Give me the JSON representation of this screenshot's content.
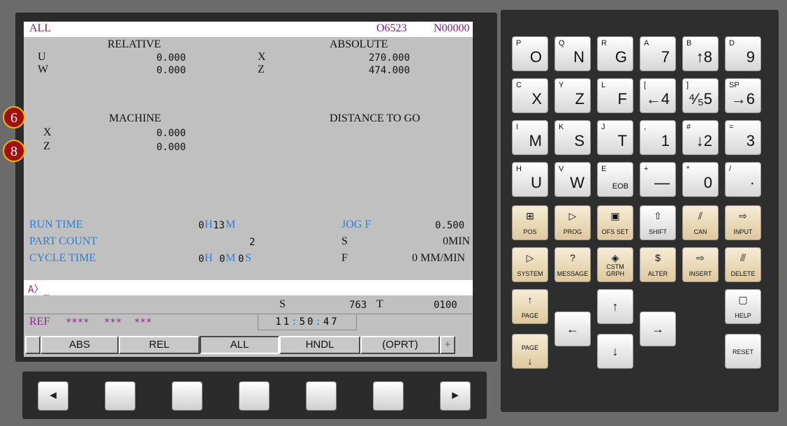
{
  "screen": {
    "mode_label": "ALL",
    "program_no": "O6523",
    "sequence_no": "N00000",
    "relative": {
      "title": "RELATIVE",
      "u_label": "U",
      "u_value": "0.000",
      "w_label": "W",
      "w_value": "0.000"
    },
    "absolute": {
      "title": "ABSOLUTE",
      "x_label": "X",
      "x_value": "270.000",
      "z_label": "Z",
      "z_value": "474.000"
    },
    "machine": {
      "title": "MACHINE",
      "x_label": "X",
      "x_value": "0.000",
      "z_label": "Z",
      "z_value": "0.000"
    },
    "distance_to_go": {
      "title": "DISTANCE TO GO"
    },
    "run_time": {
      "label": "RUN TIME",
      "h_value": "0",
      "h_unit": "H",
      "m_value": "13",
      "m_unit": "M"
    },
    "part_count": {
      "label": "PART COUNT",
      "value": "2"
    },
    "cycle_time": {
      "label": "CYCLE TIME",
      "h_value": "0",
      "h_unit": "H",
      "m_value": "0",
      "m_unit": "M",
      "s_value": "0",
      "s_unit": "S"
    },
    "jog_f": {
      "label": "JOG F",
      "value": "0.500"
    },
    "s_line": {
      "label": "S",
      "value": "0MIN"
    },
    "f_line": {
      "label": "F",
      "value": "0 MM/MIN"
    },
    "input_prompt": "A〉_",
    "spindle": {
      "label": "S",
      "value": "763"
    },
    "tool": {
      "label": "T",
      "value": "0100"
    },
    "status": {
      "mode": "REF",
      "s1": "****",
      "s2": "***",
      "s3": "***"
    },
    "clock": {
      "hh": "11",
      "mm": "50",
      "ss": "47",
      "sep": ":"
    },
    "softkeys": [
      "ABS",
      "REL",
      "ALL",
      "HNDL",
      "(OPRT)",
      "+"
    ],
    "active_softkey": "ALL"
  },
  "annotations": [
    "6",
    "8"
  ],
  "bottom_buttons": [
    "◄",
    "",
    "",
    "",
    "",
    "",
    "►"
  ],
  "keypad": {
    "rows": [
      [
        {
          "sub": "P",
          "main": "O"
        },
        {
          "sub": "Q",
          "main": "N"
        },
        {
          "sub": "R",
          "main": "G"
        },
        {
          "sub": "A",
          "main": "7"
        },
        {
          "sub": "B",
          "main": "↑8"
        },
        {
          "sub": "D",
          "main": "9"
        }
      ],
      [
        {
          "sub": "C",
          "main": "X"
        },
        {
          "sub": "Y",
          "main": "Z"
        },
        {
          "sub": "L",
          "main": "F"
        },
        {
          "sub": "[",
          "main": "←4"
        },
        {
          "sub": "]",
          "main": "⁴⁄₅5"
        },
        {
          "sub": "SP",
          "main": "→6"
        }
      ],
      [
        {
          "sub": "I",
          "main": "M"
        },
        {
          "sub": "K",
          "main": "S"
        },
        {
          "sub": "J",
          "main": "T"
        },
        {
          "sub": ",",
          "main": "1"
        },
        {
          "sub": "#",
          "main": "↓2"
        },
        {
          "sub": "=",
          "main": "3"
        }
      ],
      [
        {
          "sub": "H",
          "main": "U"
        },
        {
          "sub": "V",
          "main": "W"
        },
        {
          "sub": "E",
          "main": "EOB"
        },
        {
          "sub": "+",
          "main": "—"
        },
        {
          "sub": "*",
          "main": "0"
        },
        {
          "sub": "/",
          "main": "·"
        }
      ]
    ],
    "function_rows": [
      [
        {
          "icon": "⊞",
          "label": "POS"
        },
        {
          "icon": "▷",
          "label": "PROG"
        },
        {
          "icon": "▣",
          "label": "OFS SET"
        },
        {
          "icon": "⇧",
          "label": "SHIFT"
        },
        {
          "icon": "⫽",
          "label": "CAN"
        },
        {
          "icon": "⇨",
          "label": "INPUT"
        }
      ],
      [
        {
          "icon": "▷",
          "label": "SYSTEM"
        },
        {
          "icon": "?",
          "label": "MESSAGE"
        },
        {
          "icon": "◈",
          "label": "CSTM GRPH"
        },
        {
          "icon": "$",
          "label": "ALTER"
        },
        {
          "icon": "⇨",
          "label": "INSERT"
        },
        {
          "icon": "⫻",
          "label": "DELETE"
        }
      ]
    ],
    "page_up": {
      "icon": "↑",
      "label": "PAGE"
    },
    "page_down": {
      "icon": "↓",
      "label": "PAGE"
    },
    "arrow_up": "↑",
    "arrow_left": "←",
    "arrow_right": "→",
    "arrow_down": "↓",
    "help": {
      "icon": "▢",
      "label": "HELP"
    },
    "reset": {
      "label": "RESET"
    }
  }
}
